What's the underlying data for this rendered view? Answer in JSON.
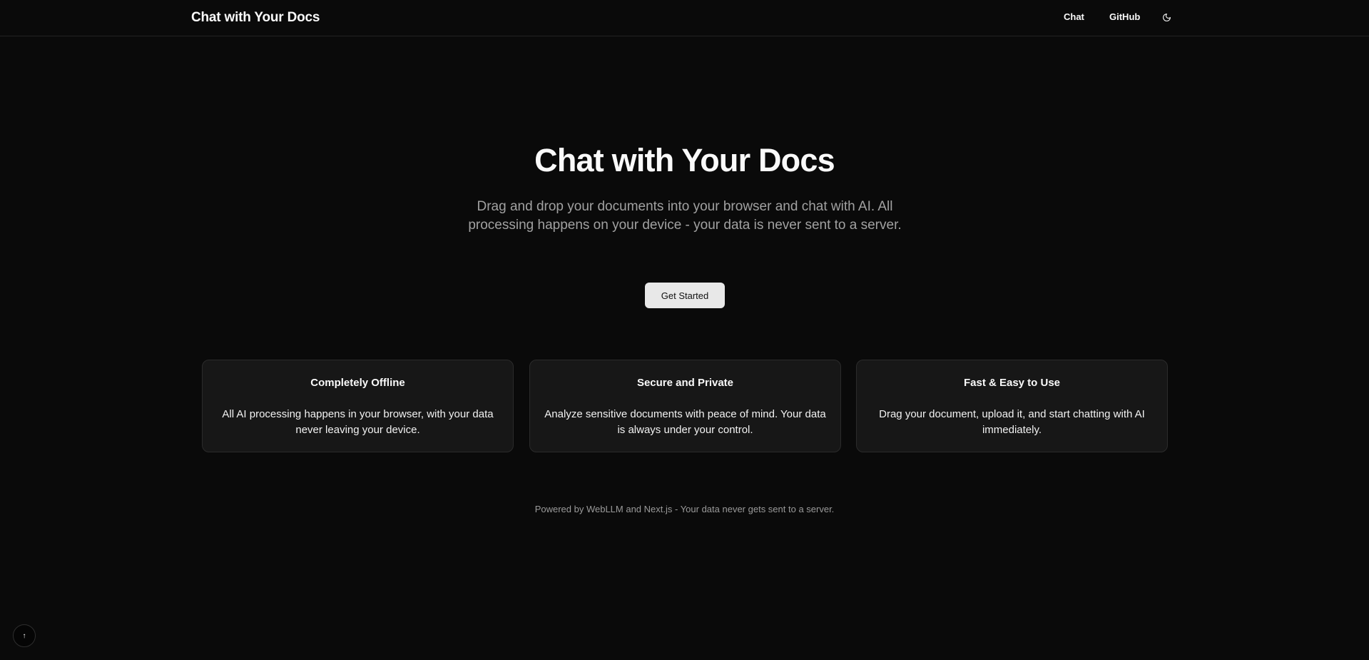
{
  "header": {
    "brand": "Chat with Your Docs",
    "nav": {
      "chat": "Chat",
      "github": "GitHub"
    },
    "theme_toggle_icon": "moon-icon"
  },
  "hero": {
    "title": "Chat with Your Docs",
    "subtitle": "Drag and drop your documents into your browser and chat with AI. All processing happens on your device - your data is never sent to a server.",
    "cta_label": "Get Started"
  },
  "features": [
    {
      "title": "Completely Offline",
      "body": "All AI processing happens in your browser, with your data never leaving your device."
    },
    {
      "title": "Secure and Private",
      "body": "Analyze sensitive documents with peace of mind. Your data is always under your control."
    },
    {
      "title": "Fast & Easy to Use",
      "body": "Drag your document, upload it, and start chatting with AI immediately."
    }
  ],
  "footer": {
    "text": "Powered by WebLLM and Next.js - Your data never gets sent to a server."
  },
  "scroll_top": {
    "glyph": "↑",
    "icon": "arrow-up-icon"
  },
  "colors": {
    "background": "#0a0a0a",
    "card": "#171717",
    "muted_text": "#a1a1a1",
    "button": "#e8e8e8"
  }
}
